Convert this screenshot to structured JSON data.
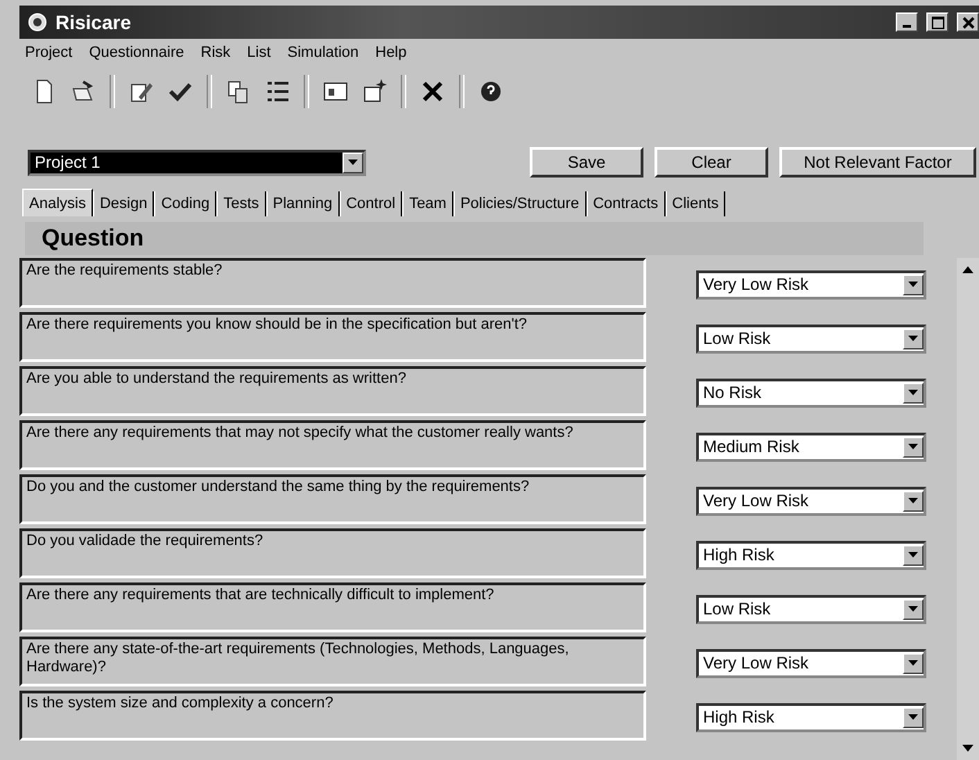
{
  "window": {
    "title": "Risicare"
  },
  "menu": [
    "Project",
    "Questionnaire",
    "Risk",
    "List",
    "Simulation",
    "Help"
  ],
  "project": {
    "value": "Project 1"
  },
  "buttons": [
    "Save",
    "Clear",
    "Not Relevant Factor"
  ],
  "tabs": [
    {
      "label": "Analysis",
      "selected": true
    },
    {
      "label": "Design",
      "selected": false
    },
    {
      "label": "Coding",
      "selected": false
    },
    {
      "label": "Tests",
      "selected": false
    },
    {
      "label": "Planning",
      "selected": false
    },
    {
      "label": "Control",
      "selected": false
    },
    {
      "label": "Team",
      "selected": false
    },
    {
      "label": "Policies/Structure",
      "selected": false
    },
    {
      "label": "Contracts",
      "selected": false
    },
    {
      "label": "Clients",
      "selected": false
    }
  ],
  "header": "Question",
  "questions": [
    {
      "text": "Are the requirements stable?",
      "risk": "Very Low Risk"
    },
    {
      "text": "Are there requirements you know should be in the specification but aren't?",
      "risk": "Low Risk"
    },
    {
      "text": "Are you able to understand the requirements as written?",
      "risk": "No Risk"
    },
    {
      "text": "Are there any requirements that may not specify what the customer really wants?",
      "risk": "Medium Risk"
    },
    {
      "text": "Do you and the customer understand the same thing by the requirements?",
      "risk": "Very Low Risk"
    },
    {
      "text": "Do you validade the requirements?",
      "risk": "High Risk"
    },
    {
      "text": "Are there any requirements that are technically difficult to implement?",
      "risk": "Low Risk"
    },
    {
      "text": "Are there any state-of-the-art requirements (Technologies,  Methods, Languages, Hardware)?",
      "risk": "Very Low Risk"
    },
    {
      "text": "Is the system size and complexity a concern?",
      "risk": "High Risk"
    }
  ]
}
